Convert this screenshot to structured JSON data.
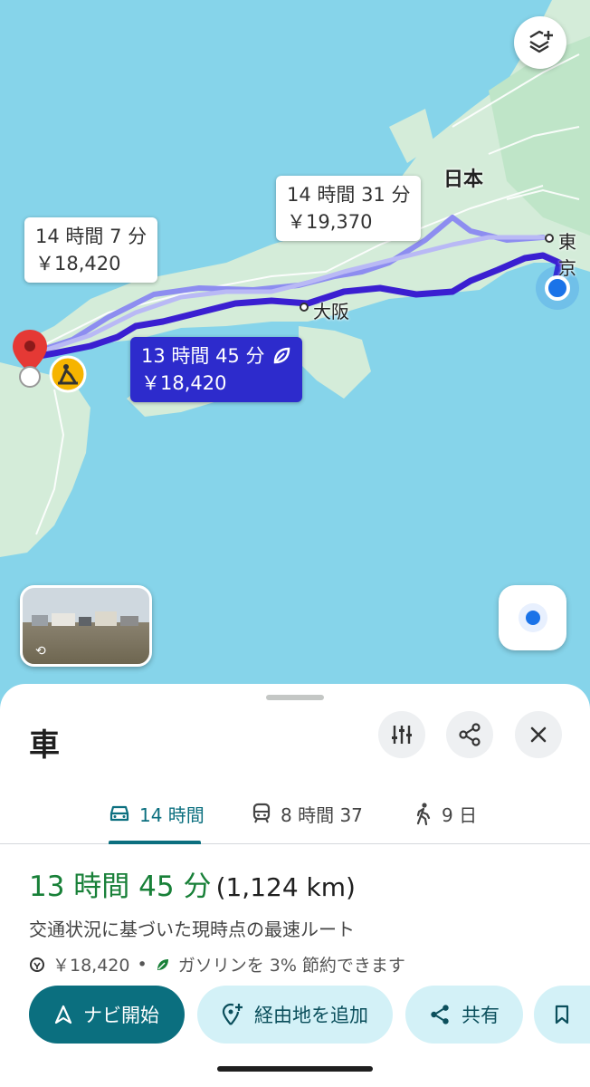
{
  "map": {
    "callouts": {
      "route_a_time": "14 時間 7 分",
      "route_a_cost": "￥18,420",
      "route_b_time": "14 時間 31 分",
      "route_b_cost": "￥19,370",
      "route_main_time": "13 時間 45 分",
      "route_main_cost": "￥18,420"
    },
    "labels": {
      "country": "日本",
      "city_osaka": "大阪",
      "city_tokyo": "東京"
    },
    "icons": {
      "layers": "layers-icon",
      "my_location": "my-location-icon",
      "destination": "destination-pin-icon",
      "road_work": "road-work-icon",
      "eco": "eco-leaf-icon",
      "street_view_rotate": "rotate-icon"
    },
    "colors": {
      "route_main": "#3a1fd1",
      "route_alt": "#8d8df0",
      "water": "#86d4ea",
      "land": "#d4ecd9",
      "pin": "#e53935",
      "road_work_badge": "#f6b400",
      "current_location": "#1a73e8"
    }
  },
  "sheet": {
    "title": "車",
    "tabs": [
      {
        "label": "14 時間",
        "icon": "car-icon",
        "active": true
      },
      {
        "label": "8 時間 37",
        "icon": "train-icon",
        "active": false
      },
      {
        "label": "9 日",
        "icon": "walk-icon",
        "active": false
      }
    ],
    "summary": {
      "duration": "13 時間 45 分",
      "distance": "(1,124 km)",
      "description": "交通状況に基づいた現時点の最速ルート",
      "toll": "￥18,420",
      "separator": "•",
      "fuel_saving": "ガソリンを 3% 節約できます"
    },
    "actions": {
      "start": "ナビ開始",
      "add_stop": "経由地を追加",
      "share": "共有"
    },
    "accent": "#0b6f7f"
  }
}
